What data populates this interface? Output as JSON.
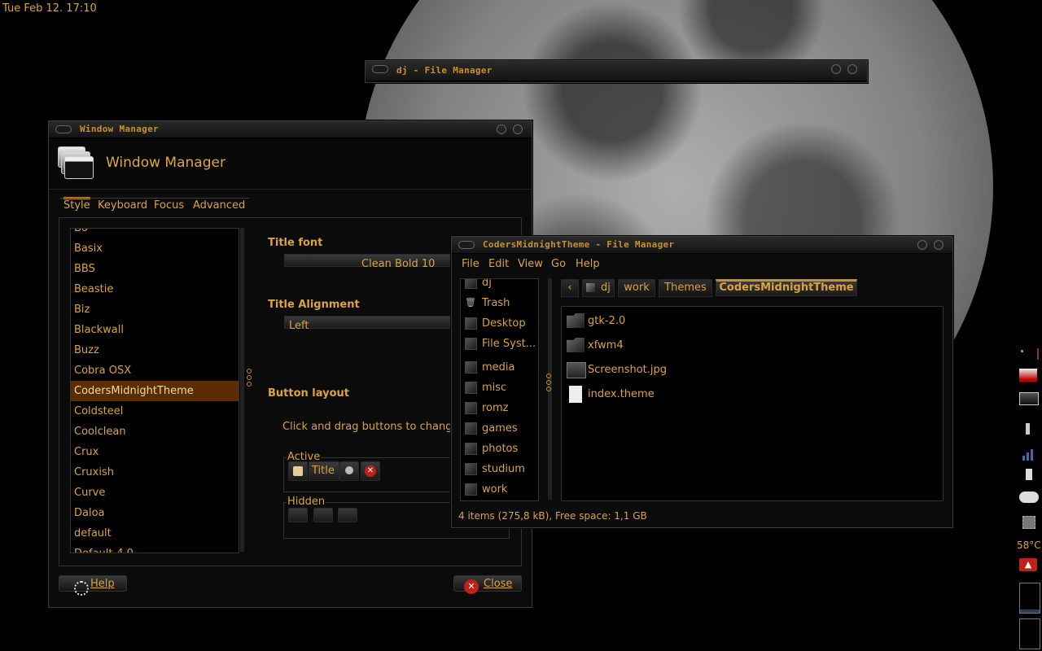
{
  "desktop": {
    "clock": "Tue Feb 12. 17:10"
  },
  "wm_window": {
    "title": "Window Manager",
    "heading": "Window Manager",
    "tabs": [
      "Style",
      "Keyboard",
      "Focus",
      "Advanced"
    ],
    "active_tab": "Style",
    "themes": [
      "Bo",
      "Basix",
      "BBS",
      "Beastie",
      "Biz",
      "Blackwall",
      "Buzz",
      "Cobra OSX",
      "CodersMidnightTheme",
      "Coldsteel",
      "Coolclean",
      "Crux",
      "Cruxish",
      "Curve",
      "Daloa",
      "default",
      "Default-4.0"
    ],
    "selected_theme": "CodersMidnightTheme",
    "title_font_label": "Title font",
    "title_font_value": "Clean Bold 10",
    "title_alignment_label": "Title Alignment",
    "title_alignment_value": "Left",
    "button_layout_label": "Button layout",
    "button_layout_hint": "Click and drag buttons to change",
    "active_label": "Active",
    "active_title_button": "Title",
    "hidden_label": "Hidden",
    "help_button": "Help",
    "close_button": "Close"
  },
  "fm_dj_window": {
    "title": "dj - File Manager"
  },
  "fm_window": {
    "title": "CodersMidnightTheme - File Manager",
    "menu": [
      "File",
      "Edit",
      "View",
      "Go",
      "Help"
    ],
    "places": [
      {
        "label": "dj",
        "icon": "home-icon"
      },
      {
        "label": "Trash",
        "icon": "trash-icon"
      },
      {
        "label": "Desktop",
        "icon": "desktop-icon"
      },
      {
        "label": "File Syst...",
        "icon": "filesystem-icon"
      },
      {
        "label": "media",
        "icon": "folder-icon"
      },
      {
        "label": "misc",
        "icon": "folder-icon"
      },
      {
        "label": "romz",
        "icon": "folder-icon"
      },
      {
        "label": "games",
        "icon": "folder-icon"
      },
      {
        "label": "photos",
        "icon": "folder-icon"
      },
      {
        "label": "studium",
        "icon": "folder-icon"
      },
      {
        "label": "work",
        "icon": "folder-icon"
      }
    ],
    "path": [
      "dj",
      "work",
      "Themes",
      "CodersMidnightTheme"
    ],
    "files": [
      {
        "name": "gtk-2.0",
        "icon": "folder-icon"
      },
      {
        "name": "xfwm4",
        "icon": "folder-icon"
      },
      {
        "name": "Screenshot.jpg",
        "icon": "image-file-icon"
      },
      {
        "name": "index.theme",
        "icon": "text-file-icon"
      }
    ],
    "status": "4 items (275,8 kB), Free space: 1,1 GB"
  },
  "panel": {
    "temperature": "58°C"
  },
  "colors": {
    "accent": "#d9a441",
    "selection": "#5a2d07",
    "background": "#000000"
  }
}
